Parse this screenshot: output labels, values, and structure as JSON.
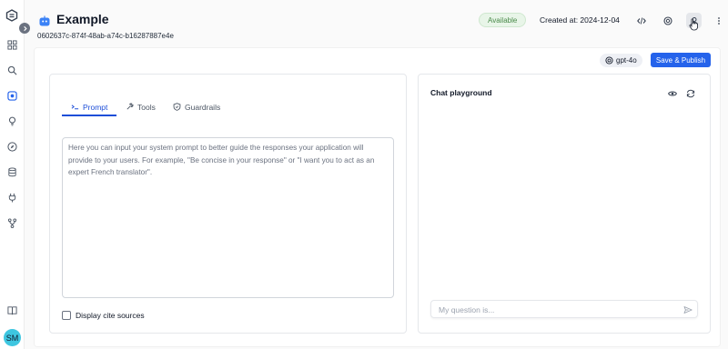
{
  "sidebar": {
    "logo_icon": "logo-icon",
    "items": [
      {
        "name": "sidebar-item-dashboard",
        "icon": "grid-icon"
      },
      {
        "name": "sidebar-item-search",
        "icon": "search-icon"
      },
      {
        "name": "sidebar-item-apps",
        "icon": "app-icon"
      },
      {
        "name": "sidebar-item-ideas",
        "icon": "lightbulb-icon"
      },
      {
        "name": "sidebar-item-explore",
        "icon": "compass-icon"
      },
      {
        "name": "sidebar-item-data",
        "icon": "database-icon"
      },
      {
        "name": "sidebar-item-integrations",
        "icon": "plug-icon"
      },
      {
        "name": "sidebar-item-workflows",
        "icon": "branch-icon"
      },
      {
        "name": "sidebar-item-docs",
        "icon": "book-icon"
      }
    ],
    "avatar_initials": "SM"
  },
  "header": {
    "title": "Example",
    "app_id": "0602637c-874f-48ab-a74c-b16287887e4e",
    "status": "Available",
    "created_at": "Created at: 2024-12-04",
    "actions": [
      "code-icon",
      "openai-icon",
      "user-settings-icon",
      "more-vertical-icon"
    ]
  },
  "toolbar": {
    "model": "gpt-4o",
    "publish_label": "Save & Publish"
  },
  "editor": {
    "tabs": [
      {
        "label": "Prompt",
        "icon": "terminal-icon",
        "active": true
      },
      {
        "label": "Tools",
        "icon": "tools-icon",
        "active": false
      },
      {
        "label": "Guardrails",
        "icon": "shield-icon",
        "active": false
      }
    ],
    "prompt_placeholder": "Here you can input your system prompt to better guide the responses your application will provide to your users. For example, \"Be concise in your response\" or \"I want you to act as an expert French translator\".",
    "cite_label": "Display cite sources"
  },
  "playground": {
    "title": "Chat playground",
    "input_placeholder": "My question is..."
  },
  "colors": {
    "accent": "#2563eb",
    "status_bg": "#e8f5e8",
    "status_text": "#4a8a4a",
    "avatar": "#3ec6e0"
  }
}
